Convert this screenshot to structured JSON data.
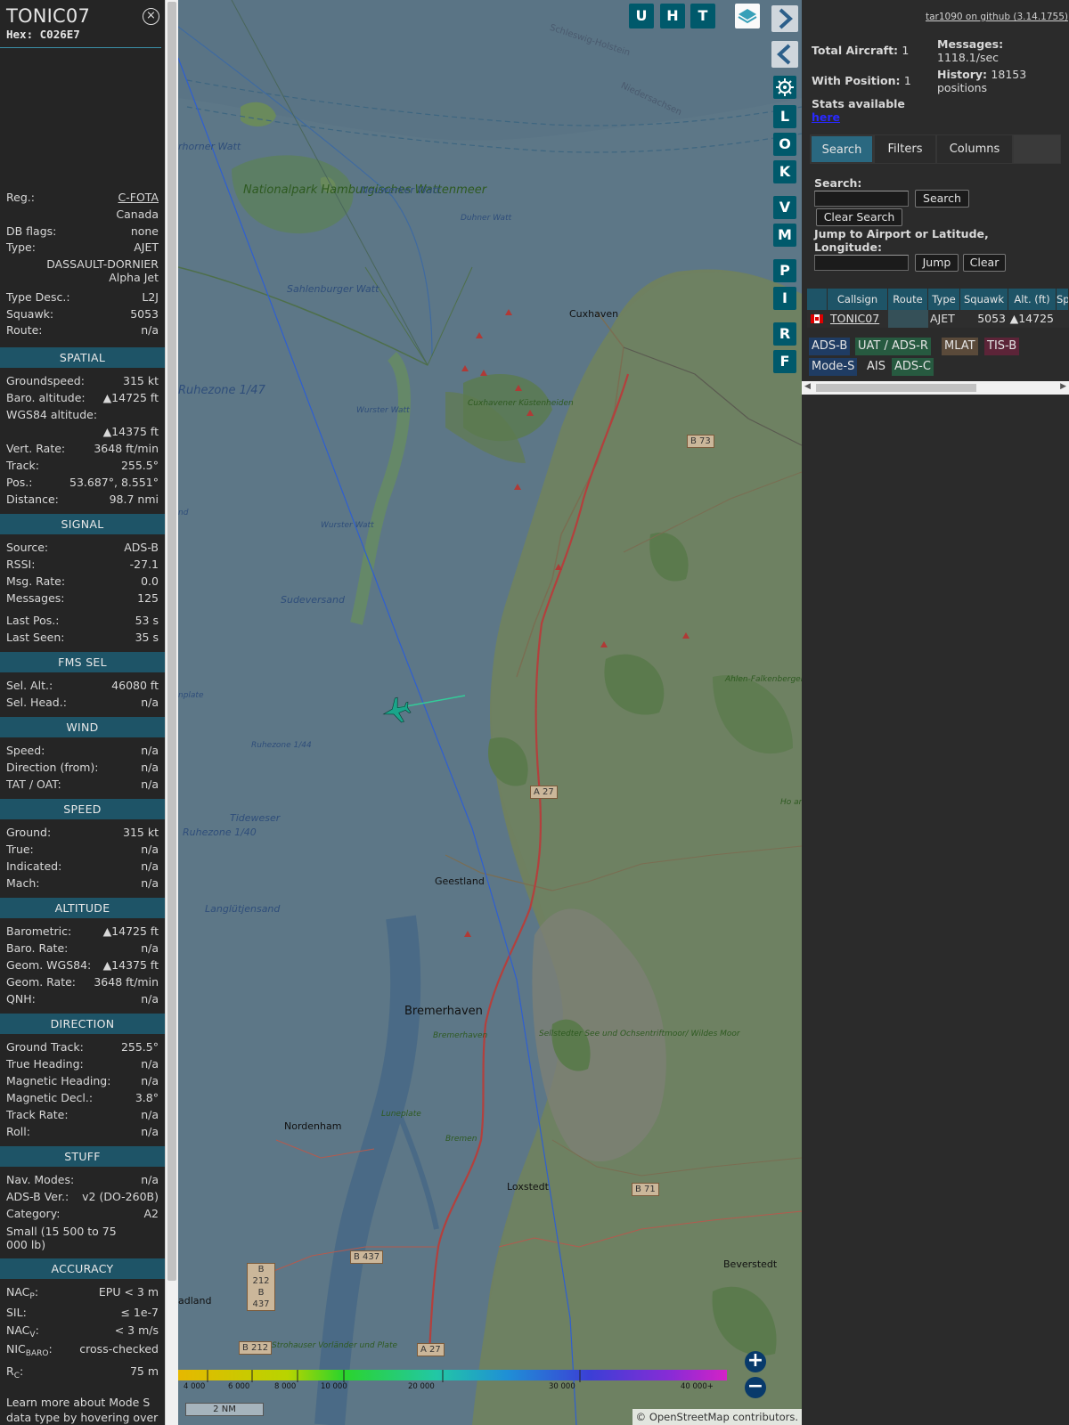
{
  "aircraft": {
    "callsign": "TONIC07",
    "hex_label": "Hex:",
    "hex": "C026E7",
    "close_glyph": "⨯",
    "details": [
      {
        "k": "Reg.:",
        "v": "C-FOTA"
      },
      {
        "v": "Canada"
      },
      {
        "k": "DB flags:",
        "v": "none"
      },
      {
        "k": "Type:",
        "v": "AJET"
      },
      {
        "v": "DASSAULT-DORNIER"
      },
      {
        "v": "Alpha Jet"
      },
      {
        "k": "Type Desc.:",
        "v": "L2J"
      },
      {
        "k": "Squawk:",
        "v": "5053"
      },
      {
        "k": "Route:",
        "v": "n/a"
      }
    ]
  },
  "sections": {
    "spatial": {
      "title": "SPATIAL",
      "rows": [
        {
          "k": "Groundspeed:",
          "v": "315 kt"
        },
        {
          "k": "Baro. altitude:",
          "v": "▲14725 ft"
        },
        {
          "k": "WGS84 altitude:",
          "v": ""
        },
        {
          "v": "▲14375 ft"
        },
        {
          "k": "Vert. Rate:",
          "v": "3648 ft/min"
        },
        {
          "k": "Track:",
          "v": "255.5°"
        },
        {
          "k": "Pos.:",
          "v": "53.687°, 8.551°"
        },
        {
          "k": "Distance:",
          "v": "98.7 nmi"
        }
      ]
    },
    "signal": {
      "title": "SIGNAL",
      "rows": [
        {
          "k": "Source:",
          "v": "ADS-B"
        },
        {
          "k": "RSSI:",
          "v": "-27.1"
        },
        {
          "k": "Msg. Rate:",
          "v": "0.0"
        },
        {
          "k": "Messages:",
          "v": "125"
        },
        {
          "k": "Last Pos.:",
          "v": "53 s"
        },
        {
          "k": "Last Seen:",
          "v": "35 s"
        }
      ]
    },
    "fms": {
      "title": "FMS SEL",
      "rows": [
        {
          "k": "Sel. Alt.:",
          "v": "46080 ft"
        },
        {
          "k": "Sel. Head.:",
          "v": "n/a"
        }
      ]
    },
    "wind": {
      "title": "WIND",
      "rows": [
        {
          "k": "Speed:",
          "v": "n/a"
        },
        {
          "k": "Direction (from):",
          "v": "n/a"
        },
        {
          "k": "TAT / OAT:",
          "v": "n/a"
        }
      ]
    },
    "speed": {
      "title": "SPEED",
      "rows": [
        {
          "k": "Ground:",
          "v": "315 kt"
        },
        {
          "k": "True:",
          "v": "n/a"
        },
        {
          "k": "Indicated:",
          "v": "n/a"
        },
        {
          "k": "Mach:",
          "v": "n/a"
        }
      ]
    },
    "altitude": {
      "title": "ALTITUDE",
      "rows": [
        {
          "k": "Barometric:",
          "v": "▲14725 ft"
        },
        {
          "k": "Baro. Rate:",
          "v": "n/a"
        },
        {
          "k": "Geom. WGS84:",
          "v": "▲14375 ft"
        },
        {
          "k": "Geom. Rate:",
          "v": "3648 ft/min"
        },
        {
          "k": "QNH:",
          "v": "n/a"
        }
      ]
    },
    "direction": {
      "title": "DIRECTION",
      "rows": [
        {
          "k": "Ground Track:",
          "v": "255.5°"
        },
        {
          "k": "True Heading:",
          "v": "n/a"
        },
        {
          "k": "Magnetic Heading:",
          "v": "n/a"
        },
        {
          "k": "Magnetic Decl.:",
          "v": "3.8°"
        },
        {
          "k": "Track Rate:",
          "v": "n/a"
        },
        {
          "k": "Roll:",
          "v": "n/a"
        }
      ]
    },
    "stuff": {
      "title": "STUFF",
      "rows": [
        {
          "k": "Nav. Modes:",
          "v": "n/a"
        },
        {
          "k": "ADS-B Ver.:",
          "v": "v2 (DO-260B)"
        },
        {
          "k": "Category:",
          "v": "A2"
        }
      ],
      "category_desc": "Small (15 500 to 75 000 lb)"
    },
    "accuracy": {
      "title": "ACCURACY",
      "nacp_k": "NAC",
      "nacp_sub": "P",
      "nacp_v": "EPU < 3 m",
      "sil_k": "SIL:",
      "sil_v": "≤ 1e-7",
      "nacv_k": "NAC",
      "nacv_sub": "V",
      "nacv_v": "< 3 m/s",
      "nicbaro_k": "NIC",
      "nicbaro_sub": "BARO",
      "nicbaro_v": "cross-checked",
      "rc_k": "R",
      "rc_sub": "C",
      "rc_v": "75 m"
    },
    "learn_more": "Learn more about Mode S data type by hovering over"
  },
  "map": {
    "buttons": {
      "u": "U",
      "h": "H",
      "t": "T",
      "l": "L",
      "o": "O",
      "k": "K",
      "v": "V",
      "m": "M",
      "p": "P",
      "i": "I",
      "r": "R",
      "f": "F"
    },
    "icons": {
      "layers": "layers-icon",
      "expand": "chevron-right-icon",
      "collapse": "chevron-left-icon",
      "split": "split-arrows-icon",
      "settings": "gear-icon"
    },
    "zoom_in": "+",
    "zoom_out": "−",
    "labels": {
      "cuxhaven": "Cuxhaven",
      "geestland": "Geestland",
      "bremerhaven": "Bremerhaven",
      "nordenham": "Nordenham",
      "loxstedt": "Loxstedt",
      "beverstedt": "Beverstedt",
      "nationalpark": "Nationalpark Hamburgisches Wattenmeer",
      "neuwerker": "Neuwerker Watt",
      "duhner": "Duhner Watt",
      "sahlenburger": "Sahlenburger Watt",
      "cuxhavener_kh": "Cuxhavener Küstenheiden",
      "wurster_watt_1": "Wurster Watt",
      "wurster_watt_2": "Wurster Watt",
      "sudeversand": "Sudeversand",
      "ruhezone_147": "Ruhezone 1/47",
      "ruhezone_144": "Ruhezone 1/44",
      "ruhezone_140": "Ruhezone 1/40",
      "tideweser": "Tideweser",
      "langlutjensand": "Langlütjensand",
      "horner_watt": "rhorner Watt",
      "ahlen": "Ahlen-Falkenberger Moor, Halemer Dahlemer See",
      "sellstedter": "Sellstedter See und Ochsentriftmoor/ Wildes Moor",
      "luneplate": "Luneplate",
      "bremerhaven_green": "Bremerhaven",
      "bremen_river": "Bremen",
      "strohauser": "Strohauser Vorländer und Plate",
      "schleswig": "Schleswig-Holstein",
      "niedersachsen": "Niedersachsen",
      "adland": "adland",
      "plate_left": "nplate",
      "nd_left": "nd",
      "am_b": "Ho am B"
    },
    "roads": {
      "b73": "B 73",
      "a27_1": "A 27",
      "a27_2": "A 27",
      "b71": "B 71",
      "b437": "B 437",
      "b212_437": "B 212 B 437",
      "b212": "B 212"
    },
    "altitude_scale": {
      "ticks": [
        "4 000",
        "6 000",
        "8 000",
        "10 000",
        "20 000",
        "30 000",
        "40 000+"
      ]
    },
    "scale_nm": "2 NM",
    "attribution_prefix": "©",
    "attribution_link": "OpenStreetMap",
    "attribution_suffix": "contributors."
  },
  "right": {
    "github_link": "tar1090 on github (3.14.1755)",
    "total_aircraft_label": "Total Aircraft:",
    "total_aircraft": "1",
    "with_position_label": "With Position:",
    "with_position": "1",
    "messages_label": "Messages:",
    "messages_value": "1118.1/sec",
    "history_label": "History:",
    "history_value": "18153",
    "history_unit": "positions",
    "stats_label": "Stats available",
    "stats_link": "here",
    "tabs": [
      "Search",
      "Filters",
      "Columns"
    ],
    "search_label": "Search:",
    "search_btn": "Search",
    "clear_search_btn": "Clear Search",
    "jump_label": "Jump to Airport or Latitude, Longitude:",
    "jump_btn": "Jump",
    "clear_btn": "Clear",
    "table": {
      "headers": [
        "Callsign",
        "Route",
        "Type",
        "Squawk",
        "Alt. (ft)",
        "Sp"
      ],
      "rows": [
        {
          "callsign": "TONIC07",
          "route": "",
          "type": "AJET",
          "squawk": "5053",
          "alt": "▲14725"
        }
      ]
    },
    "sources": {
      "adsb": "ADS-B",
      "uat": "UAT / ADS-R",
      "mlat": "MLAT",
      "tisb": "TIS-B",
      "modes": "Mode-S",
      "ais": "AIS",
      "adsc": "ADS-C"
    },
    "source_colors": {
      "adsb": "#1f3c63",
      "uat": "#275a40",
      "mlat": "#5a4a3a",
      "tisb": "#5c2438",
      "modes": "#1f3c63",
      "adsc": "#275a40"
    }
  },
  "colors": {
    "accent": "#1e5467",
    "map_button": "#00596b",
    "track_line": "#2f5fd0",
    "aircraft_icon": "#1aa58a",
    "trail": "#33cc99"
  }
}
